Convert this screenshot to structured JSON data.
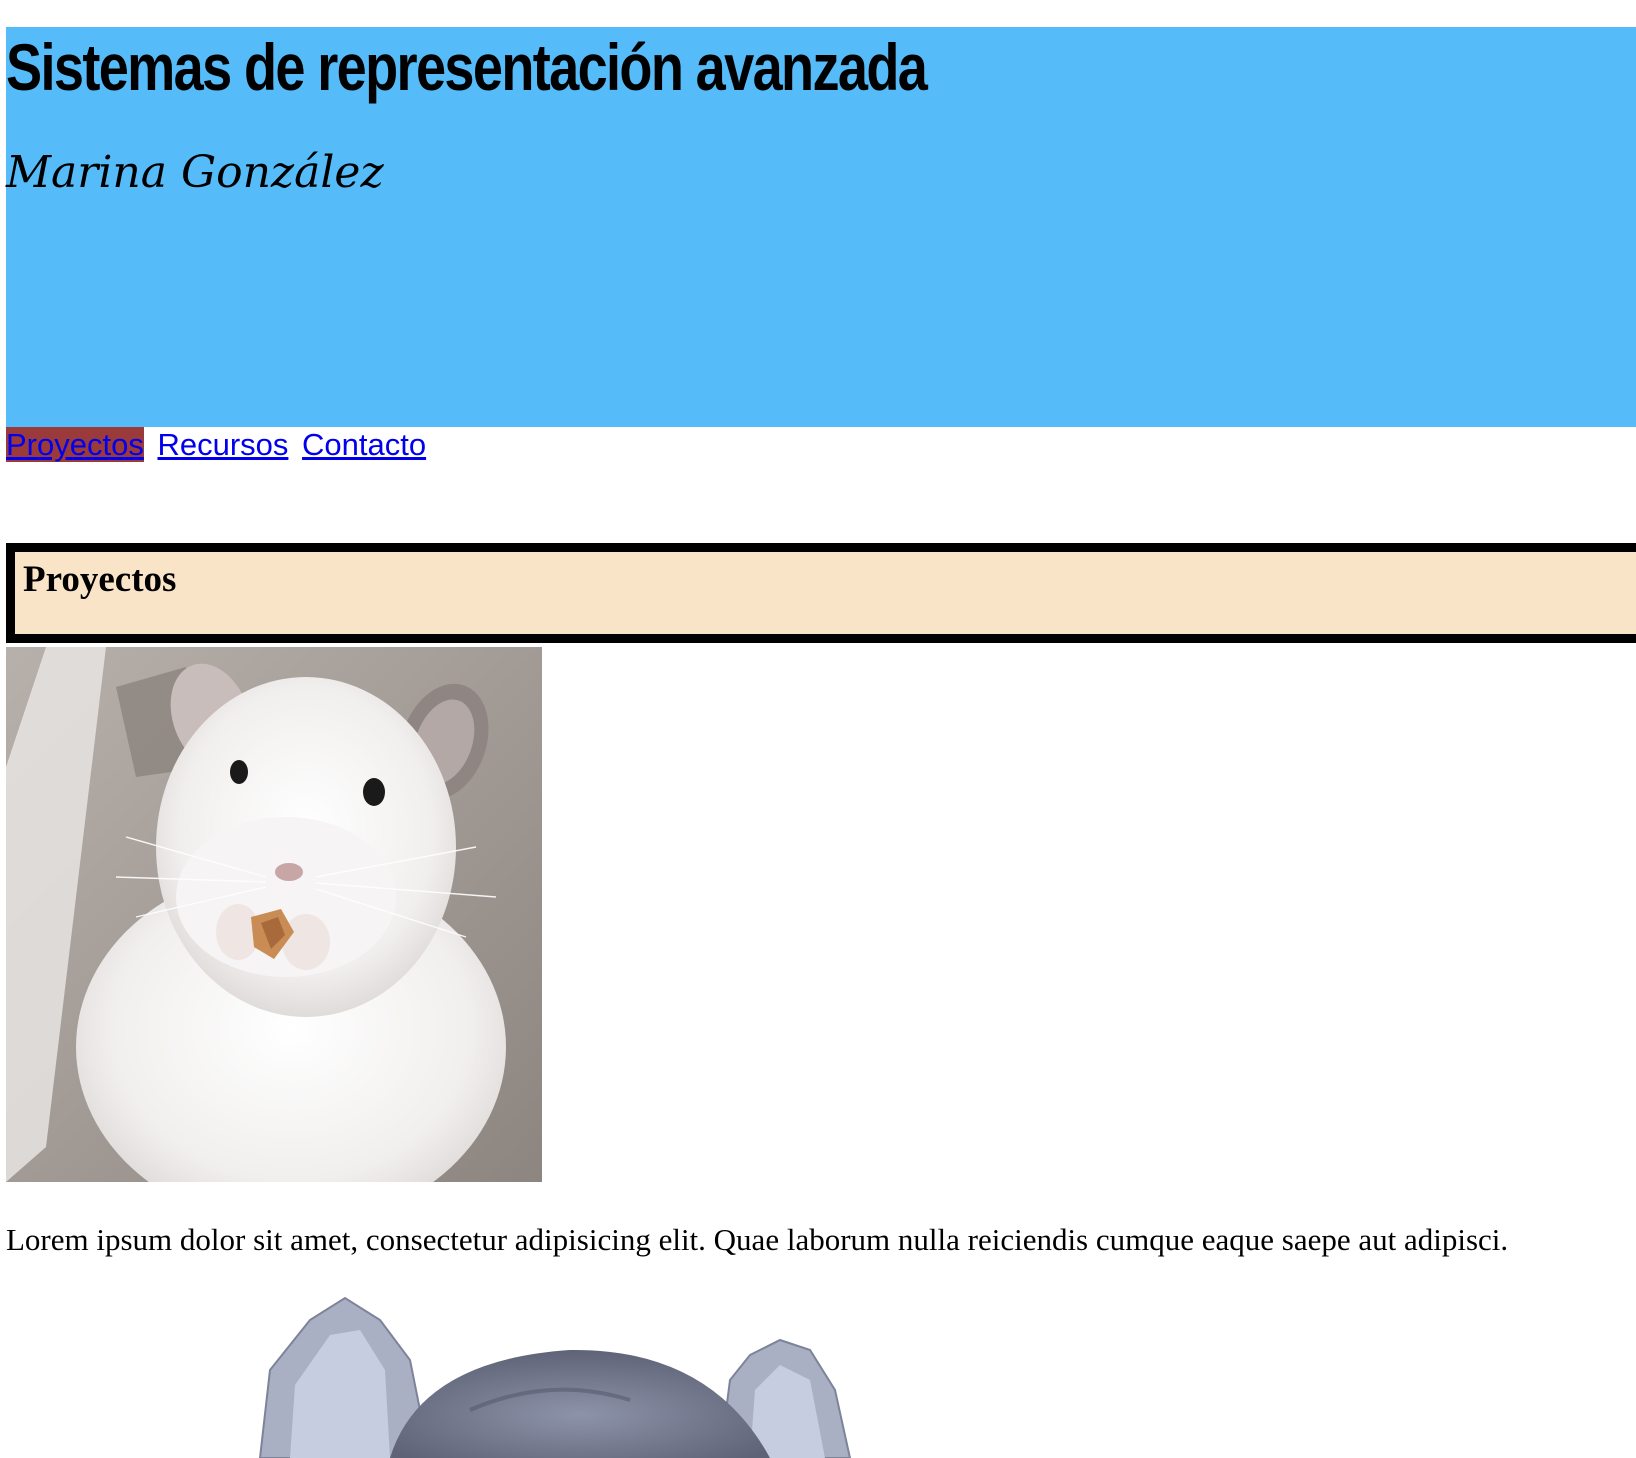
{
  "header": {
    "title": "Sistemas de representación avanzada",
    "author": "Marina González",
    "background_color": "#55bcf9"
  },
  "nav": {
    "items": [
      {
        "label": "Proyectos",
        "active": true
      },
      {
        "label": "Recursos",
        "active": false
      },
      {
        "label": "Contacto",
        "active": false
      }
    ],
    "link_color": "#0000ee",
    "active_background": "#9b3a3a"
  },
  "section": {
    "title": "Proyectos",
    "background_color": "#fae4c8"
  },
  "content": {
    "photo1_subject": "white chinchilla eating a nut",
    "paragraph": "Lorem ipsum dolor sit amet, consectetur adipisicing elit. Quae laborum nulla reiciendis cumque eaque saepe aut adipisci.",
    "photo2_subject": "grey chinchilla (cut-out photo)"
  }
}
